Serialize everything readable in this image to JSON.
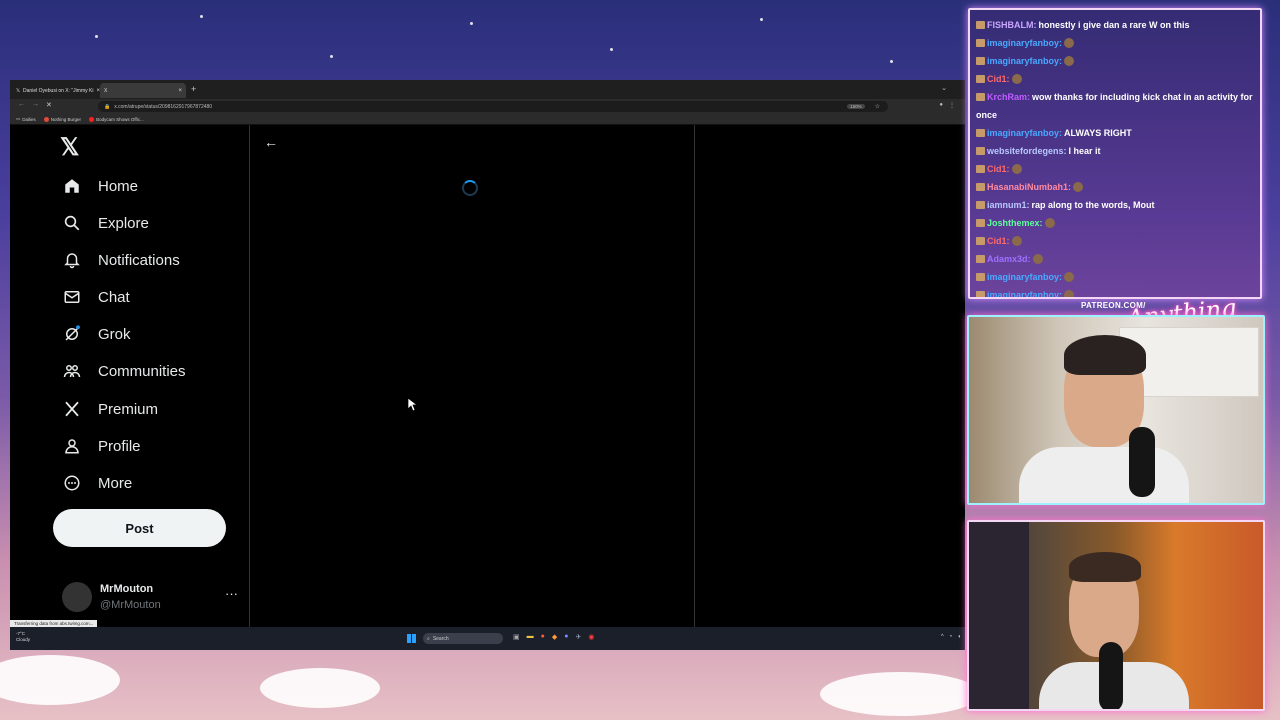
{
  "browser": {
    "tabs": [
      {
        "label": "Daniel Oyebusi on X: \"Jimmy Ki",
        "close": "×"
      },
      {
        "label": "X",
        "close": "×"
      }
    ],
    "new_tab": "+",
    "url": "x.com/atrupe/status/2098162917967872480",
    "zoom": "150%",
    "bookmarks": [
      "Dailies",
      "Nothing Burger",
      "Bodycam Shows Offic..."
    ],
    "status_text": "Transferring data from abs.twimg.com..."
  },
  "x_app": {
    "nav": [
      {
        "label": "Home",
        "icon": "home-icon"
      },
      {
        "label": "Explore",
        "icon": "search-icon"
      },
      {
        "label": "Notifications",
        "icon": "bell-icon"
      },
      {
        "label": "Chat",
        "icon": "mail-icon"
      },
      {
        "label": "Grok",
        "icon": "grok-icon"
      },
      {
        "label": "Communities",
        "icon": "people-icon"
      },
      {
        "label": "Premium",
        "icon": "x-logo-icon"
      },
      {
        "label": "Profile",
        "icon": "person-icon"
      },
      {
        "label": "More",
        "icon": "more-circle-icon"
      }
    ],
    "post_label": "Post",
    "account": {
      "name": "MrMouton",
      "handle": "@MrMouton",
      "more": "···"
    }
  },
  "taskbar": {
    "weather": [
      "-7°C",
      "Cloudy"
    ],
    "search_placeholder": "Search"
  },
  "chat": {
    "messages": [
      {
        "user": "FISHBALM:",
        "text": "honestly i give dan a rare W on this",
        "color": "#c9a6ff"
      },
      {
        "user": "imaginaryfanboy:",
        "text": "",
        "color": "#4aa8ff"
      },
      {
        "user": "imaginaryfanboy:",
        "text": "",
        "color": "#4aa8ff"
      },
      {
        "user": "Cid1:",
        "text": "",
        "color": "#ff6a6a"
      },
      {
        "user": "KrchRam:",
        "text": "wow thanks for including kick chat in an activity for once",
        "color": "#c05cff"
      },
      {
        "user": "imaginaryfanboy:",
        "text": "ALWAYS RIGHT",
        "color": "#4aa8ff"
      },
      {
        "user": "websitefordegens:",
        "text": "I hear it",
        "color": "#b8c8ff"
      },
      {
        "user": "Cid1:",
        "text": "",
        "color": "#ff6a6a"
      },
      {
        "user": "HasanabiNumbah1:",
        "text": "",
        "color": "#ff8aa0"
      },
      {
        "user": "iamnum1:",
        "text": "rap along to the words, Mout",
        "color": "#b8c8ff"
      },
      {
        "user": "Joshthemex:",
        "text": "",
        "color": "#5cff9a"
      },
      {
        "user": "Cid1:",
        "text": "",
        "color": "#ff6a6a"
      },
      {
        "user": "Adamx3d:",
        "text": "",
        "color": "#a070ff"
      },
      {
        "user": "imaginaryfanboy:",
        "text": "",
        "color": "#4aa8ff"
      },
      {
        "user": "imaginaryfanboy:",
        "text": "",
        "color": "#4aa8ff"
      }
    ]
  },
  "overlay": {
    "patreon": "PATREON.COM/",
    "brand": "Anything Else?"
  },
  "colors": {
    "accent": "#1d9bf0",
    "background": "#000000",
    "text": "#e7e9ea",
    "muted": "#71767b"
  }
}
